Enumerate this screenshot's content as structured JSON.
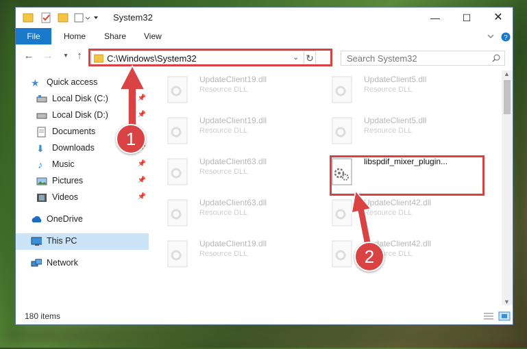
{
  "window": {
    "title": "System32"
  },
  "ribbon": {
    "tabs": [
      "File",
      "Home",
      "Share",
      "View"
    ]
  },
  "address": {
    "path": "C:\\Windows\\System32"
  },
  "search": {
    "placeholder": "Search System32"
  },
  "sidebar": {
    "items": [
      {
        "label": "Quick access"
      },
      {
        "label": "Local Disk (C:)"
      },
      {
        "label": "Local Disk (D:)"
      },
      {
        "label": "Documents"
      },
      {
        "label": "Downloads"
      },
      {
        "label": "Music"
      },
      {
        "label": "Pictures"
      },
      {
        "label": "Videos"
      },
      {
        "label": "OneDrive"
      },
      {
        "label": "This PC"
      },
      {
        "label": "Network"
      }
    ]
  },
  "files": [
    {
      "name": "UpdateClient19.dll",
      "type": "Resource DLL"
    },
    {
      "name": "UpdateClient5.dll",
      "type": "Resource DLL"
    },
    {
      "name": "UpdateClient19.dll",
      "type": "Resource DLL"
    },
    {
      "name": "UpdateClient5.dll",
      "type": "Resource DLL"
    },
    {
      "name": "UpdateClient63.dll",
      "type": "Resource DLL"
    },
    {
      "name": "libspdif_mixer_plugin...",
      "type": ""
    },
    {
      "name": "UpdateClient63.dll",
      "type": "Resource DLL"
    },
    {
      "name": "UpdateClient42.dll",
      "type": "Resource DLL"
    },
    {
      "name": "UpdateClient19.dll",
      "type": "Resource DLL"
    },
    {
      "name": "UpdateClient42.dll",
      "type": "Resource DLL"
    }
  ],
  "status": {
    "count": "180 items"
  },
  "annotations": {
    "badge1": "1",
    "badge2": "2"
  },
  "colors": {
    "accent": "#1979ca",
    "annotation": "#d94040",
    "selection": "#cce4f7"
  }
}
